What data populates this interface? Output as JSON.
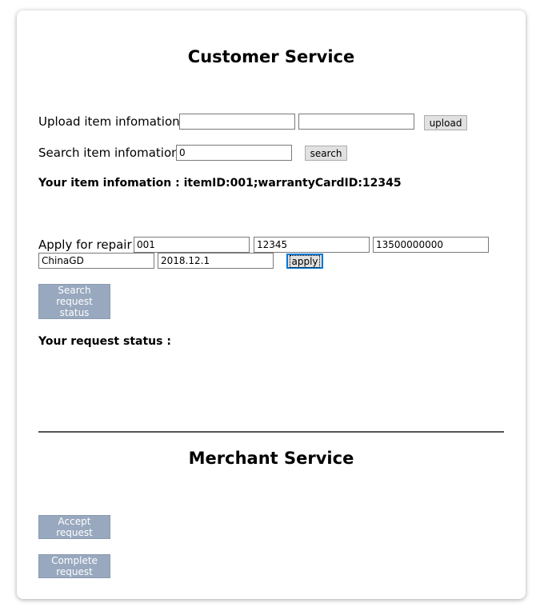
{
  "customer": {
    "title": "Customer Service",
    "upload": {
      "label": "Upload item infomation :",
      "field1_value": "",
      "field2_value": "",
      "button": "upload"
    },
    "search": {
      "label": "Search item infomation :",
      "value": "0",
      "button": "search"
    },
    "item_info": "Your item infomation : itemID:001;warrantyCardID:12345",
    "repair": {
      "label": "Apply for repair :",
      "item_id": "001",
      "warranty_id": "12345",
      "phone": "13500000000",
      "address": "ChinaGD",
      "date": "2018.12.1",
      "button": "apply"
    },
    "search_request_button": "Search request status",
    "request_status": "Your request status :"
  },
  "merchant": {
    "title": "Merchant Service",
    "accept_button": "Accept request",
    "complete_button": "Complete request"
  },
  "colors": {
    "slate_button": "#98a8be",
    "native_button": "#e1e1e1",
    "focus_border": "#0078d7"
  }
}
